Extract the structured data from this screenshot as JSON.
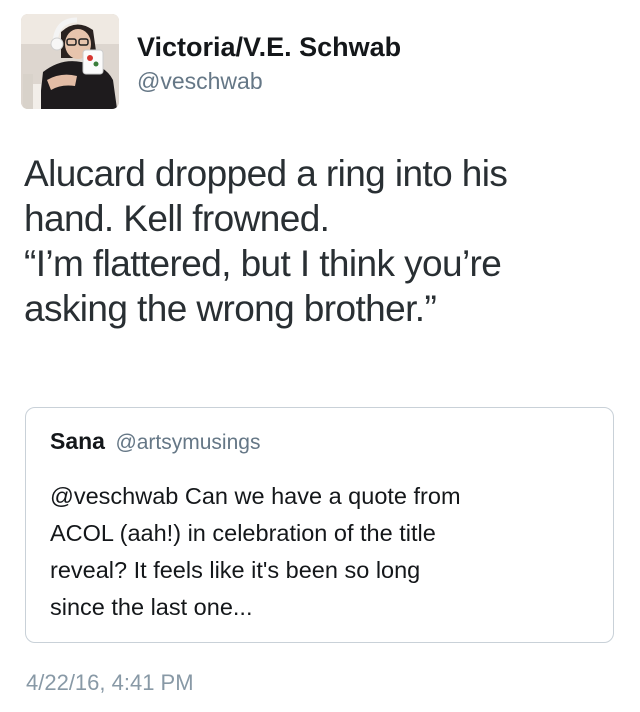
{
  "author": {
    "display_name": "Victoria/V.E. Schwab",
    "handle": "@veschwab"
  },
  "tweet": {
    "lines": [
      "Alucard dropped a ring into his",
      "hand. Kell frowned.",
      "“I’m flattered, but I think you’re",
      "asking the wrong brother.”"
    ]
  },
  "quoted_tweet": {
    "name": "Sana",
    "handle": "@artsymusings",
    "lines": [
      "@veschwab Can we have a quote from",
      "ACOL (aah!) in celebration of the title",
      "reveal? It feels like it's been so long",
      "since the last one..."
    ]
  },
  "timestamp": "4/22/16, 4:41 PM",
  "colors": {
    "primary_text": "#14171a",
    "secondary_text": "#657786",
    "timestamp_text": "#8899a6",
    "border": "#c9d1d8"
  }
}
